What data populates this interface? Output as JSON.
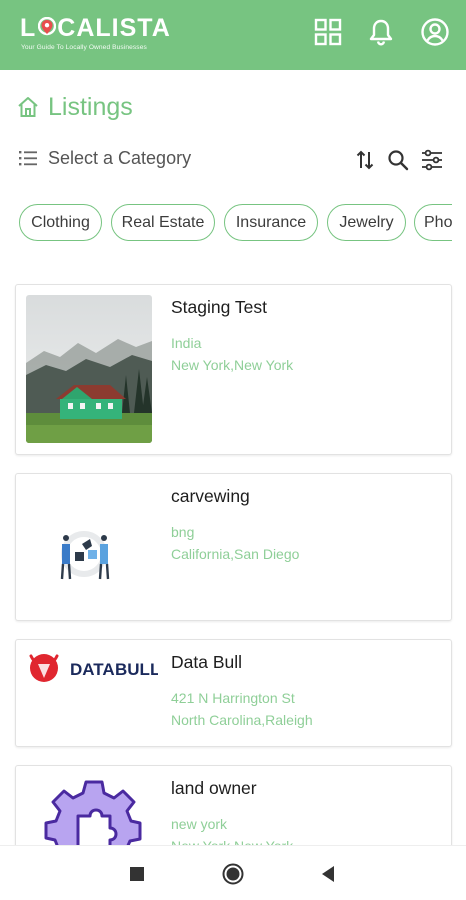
{
  "header": {
    "brand_name_lo": "L",
    "brand_name_rest": "CALISTA",
    "tagline": "Your Guide To Locally Owned Businesses"
  },
  "colors": {
    "primary": "#77c481",
    "secondary_text": "#8fcf98"
  },
  "icons": {
    "header": [
      "grid-icon",
      "bell-icon",
      "account-icon"
    ],
    "tools": [
      "sort-icon",
      "search-icon",
      "filter-icon"
    ],
    "nav": [
      "recents-square-icon",
      "home-circle-icon",
      "back-triangle-icon"
    ]
  },
  "page": {
    "title": "Listings",
    "category_label": "Select a Category"
  },
  "categories": [
    "Clothing",
    "Real Estate",
    "Insurance",
    "Jewelry",
    "Pho"
  ],
  "listings": [
    {
      "name": "Staging Test",
      "line1": "India",
      "line2": "New York,New York"
    },
    {
      "name": "carvewing",
      "line1": "bng",
      "line2": "California,San Diego"
    },
    {
      "name": "Data Bull",
      "line1": "421 N Harrington St",
      "line2": "North Carolina,Raleigh",
      "logo_text_a": "DATA",
      "logo_text_b": "BULL"
    },
    {
      "name": "land owner",
      "line1": "new york",
      "line2": "New York,New York"
    }
  ]
}
